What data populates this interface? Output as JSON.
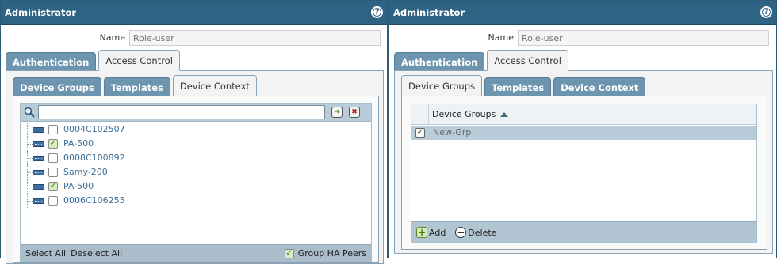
{
  "left": {
    "title": "Administrator",
    "name_label": "Name",
    "name_placeholder": "Role-user",
    "outer_tabs": [
      {
        "label": "Authentication",
        "active": false
      },
      {
        "label": "Access Control",
        "active": true
      }
    ],
    "inner_tabs": [
      {
        "label": "Device Groups",
        "active": false
      },
      {
        "label": "Templates",
        "active": false
      },
      {
        "label": "Device Context",
        "active": true
      }
    ],
    "devices": [
      {
        "label": "0004C102507",
        "checked": false
      },
      {
        "label": "PA-500",
        "checked": true
      },
      {
        "label": "0008C100892",
        "checked": false
      },
      {
        "label": "Samy-200",
        "checked": false
      },
      {
        "label": "PA-500",
        "checked": true
      },
      {
        "label": "0006C106255",
        "checked": false
      }
    ],
    "footer": {
      "select_all": "Select All",
      "deselect_all": "Deselect All",
      "group_ha_peers": "Group HA Peers",
      "group_ha_checked": true
    }
  },
  "right": {
    "title": "Administrator",
    "name_label": "Name",
    "name_placeholder": "Role-user",
    "outer_tabs": [
      {
        "label": "Authentication",
        "active": false
      },
      {
        "label": "Access Control",
        "active": true
      }
    ],
    "inner_tabs": [
      {
        "label": "Device Groups",
        "active": true
      },
      {
        "label": "Templates",
        "active": false
      },
      {
        "label": "Device Context",
        "active": false
      }
    ],
    "grid_header": "Device Groups",
    "rows": [
      {
        "label": "New-Grp",
        "checked": true
      }
    ],
    "add_label": "Add",
    "delete_label": "Delete"
  },
  "icons": {
    "help": "help-icon",
    "search": "search-icon",
    "go": "arrow-right-icon",
    "clear": "close-icon",
    "device": "firewall-device-icon",
    "add": "plus-icon",
    "delete": "minus-icon"
  },
  "colors": {
    "titlebar": "#2e6384",
    "tab": "#6e95b0",
    "selected_row": "#b9ccd9",
    "device_text": "#3c6d98",
    "check_green": "#3c8a0f"
  }
}
